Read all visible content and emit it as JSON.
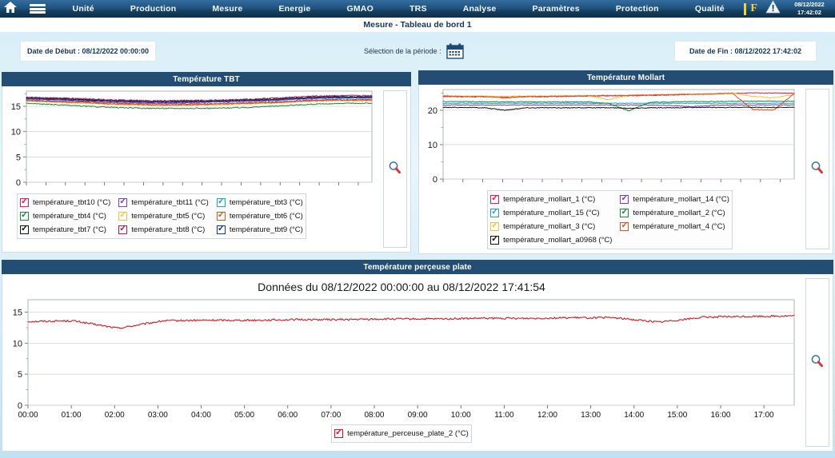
{
  "menubar": {
    "home_icon": "home-icon",
    "hamburger_icon": "hamburger-menu-icon",
    "items": [
      {
        "label": "Unité"
      },
      {
        "label": "Production"
      },
      {
        "label": "Mesure"
      },
      {
        "label": "Energie"
      },
      {
        "label": "GMAO"
      },
      {
        "label": "TRS"
      },
      {
        "label": "Analyse"
      },
      {
        "label": "Paramètres"
      },
      {
        "label": "Protection"
      },
      {
        "label": "Qualité"
      }
    ],
    "indicator_separator": "|",
    "indicator_letter": "F",
    "warning_icon": "warning-triangle-icon",
    "clock_date": "08/12/2022",
    "clock_time": "17:42:02",
    "accent_yellow": "#f4d23c",
    "bar_color": "#20527e"
  },
  "page": {
    "title": "Mesure - Tableau de bord 1"
  },
  "filters": {
    "date_debut": "Date de Début : 08/12/2022 00:00:00",
    "periode_label": "Sélection de la période :",
    "calendar_icon": "calendar-icon",
    "date_fin": "Date de Fin : 08/12/2022 17:42:02"
  },
  "panels": {
    "tbt": {
      "title": "Température TBT",
      "zoom_icon": "magnifier-icon"
    },
    "mollart": {
      "title": "Température Mollart",
      "zoom_icon": "magnifier-icon"
    },
    "perceuse": {
      "title": "Température perçeuse plate",
      "subtitle": "Données du 08/12/2022 00:00:00 au 08/12/2022 17:41:54",
      "zoom_icon": "magnifier-icon"
    }
  },
  "chart_data": [
    {
      "id": "tbt",
      "type": "line",
      "title": "Température TBT",
      "xlabel": "",
      "ylabel": "",
      "ylim": [
        0,
        18
      ],
      "yticks": [
        0,
        5,
        10,
        15
      ],
      "xlim": [
        0,
        17.7
      ],
      "grid": true,
      "legend_position": "bottom",
      "x_unit": "hours",
      "series": [
        {
          "name": "température_tbt10 (°C)",
          "color": "#e8194b",
          "checked": true,
          "values": [
            16.2,
            16.1,
            16.0,
            15.9,
            15.7,
            15.6,
            15.5,
            15.5,
            15.5,
            15.5,
            15.6,
            15.7,
            15.8,
            16.0,
            16.2,
            16.3,
            16.3,
            16.3
          ]
        },
        {
          "name": "température_tbt11 (°C)",
          "color": "#7a3fb5",
          "checked": true,
          "values": [
            16.6,
            16.5,
            16.4,
            16.3,
            16.1,
            16.0,
            15.9,
            15.9,
            15.9,
            16.0,
            16.1,
            16.2,
            16.3,
            16.5,
            16.7,
            16.8,
            16.8,
            16.8
          ]
        },
        {
          "name": "température_tbt3 (°C)",
          "color": "#1f9fe0",
          "checked": true,
          "values": [
            16.4,
            16.3,
            16.2,
            16.0,
            15.9,
            15.8,
            15.7,
            15.7,
            15.7,
            15.8,
            15.9,
            16.0,
            16.1,
            16.3,
            16.5,
            16.6,
            16.6,
            16.6
          ]
        },
        {
          "name": "température_tbt4 (°C)",
          "color": "#1b8a3a",
          "checked": true,
          "values": [
            15.6,
            15.4,
            15.2,
            15.0,
            14.8,
            14.7,
            14.6,
            14.6,
            14.6,
            14.6,
            14.7,
            14.8,
            15.0,
            15.2,
            15.4,
            15.5,
            15.6,
            15.6
          ]
        },
        {
          "name": "température_tbt5 (°C)",
          "color": "#f2c43d",
          "checked": true,
          "values": [
            16.0,
            15.9,
            15.7,
            15.6,
            15.4,
            15.3,
            15.2,
            15.2,
            15.2,
            15.3,
            15.4,
            15.5,
            15.6,
            15.8,
            16.0,
            16.1,
            16.1,
            16.1
          ]
        },
        {
          "name": "température_tbt6 (°C)",
          "color": "#e0521a",
          "checked": true,
          "values": [
            16.1,
            16.0,
            15.8,
            15.7,
            15.5,
            15.4,
            15.3,
            15.3,
            15.3,
            15.4,
            15.5,
            15.6,
            15.7,
            15.9,
            16.1,
            16.2,
            16.2,
            16.2
          ]
        },
        {
          "name": "température_tbt7 (°C)",
          "color": "#111111",
          "checked": true,
          "values": [
            16.7,
            16.6,
            16.5,
            16.3,
            16.2,
            16.1,
            16.0,
            16.0,
            16.0,
            16.1,
            16.2,
            16.3,
            16.4,
            16.6,
            16.8,
            16.9,
            16.9,
            16.9
          ]
        },
        {
          "name": "température_tbt8 (°C)",
          "color": "#b5185b",
          "checked": true,
          "values": [
            16.8,
            16.7,
            16.6,
            16.5,
            16.3,
            16.2,
            16.1,
            16.1,
            16.2,
            16.2,
            16.3,
            16.4,
            16.6,
            16.8,
            17.0,
            17.1,
            17.1,
            17.1
          ]
        },
        {
          "name": "température_tbt9 (°C)",
          "color": "#1a2f9e",
          "checked": true,
          "values": [
            16.5,
            16.4,
            16.3,
            16.1,
            16.0,
            15.9,
            15.8,
            15.8,
            15.8,
            15.9,
            16.0,
            16.1,
            16.2,
            16.4,
            16.6,
            16.7,
            16.7,
            16.7
          ]
        }
      ]
    },
    {
      "id": "mollart",
      "type": "line",
      "title": "Température Mollart",
      "xlabel": "",
      "ylabel": "",
      "ylim": [
        0,
        26
      ],
      "yticks": [
        0,
        10,
        20
      ],
      "xlim": [
        0,
        17.7
      ],
      "grid": true,
      "legend_position": "bottom",
      "x_unit": "hours",
      "series": [
        {
          "name": "température_mollart_1 (°C)",
          "color": "#e8194b",
          "checked": true,
          "values": [
            24.0,
            23.9,
            23.9,
            23.8,
            23.9,
            23.9,
            24.0,
            24.1,
            24.2,
            24.2,
            24.3,
            24.4,
            24.6,
            24.7,
            24.9,
            25.0,
            25.0,
            24.9
          ]
        },
        {
          "name": "température_mollart_14 (°C)",
          "color": "#7a3fb5",
          "checked": true,
          "values": [
            21.5,
            21.5,
            21.5,
            21.5,
            21.5,
            21.5,
            21.5,
            21.5,
            21.5,
            21.5,
            21.5,
            21.4,
            21.0,
            21.4,
            21.5,
            21.5,
            21.5,
            21.5
          ]
        },
        {
          "name": "température_mollart_15 (°C)",
          "color": "#1f9fe0",
          "checked": true,
          "values": [
            22.0,
            22.0,
            22.0,
            22.0,
            22.0,
            22.0,
            22.0,
            22.0,
            22.0,
            22.0,
            22.0,
            22.0,
            22.0,
            22.0,
            22.0,
            22.0,
            22.0,
            22.0
          ]
        },
        {
          "name": "température_mollart_2 (°C)",
          "color": "#1b8a3a",
          "checked": true,
          "values": [
            22.5,
            22.5,
            22.4,
            22.4,
            22.4,
            22.4,
            22.4,
            22.4,
            22.0,
            19.8,
            22.3,
            22.4,
            22.5,
            22.5,
            22.6,
            22.6,
            22.6,
            22.6
          ]
        },
        {
          "name": "température_mollart_3 (°C)",
          "color": "#f2c43d",
          "checked": true,
          "values": [
            24.2,
            24.1,
            24.1,
            24.0,
            24.1,
            24.1,
            24.2,
            24.3,
            23.0,
            24.4,
            24.5,
            24.6,
            24.7,
            24.8,
            25.0,
            24.0,
            23.6,
            24.6
          ]
        },
        {
          "name": "température_mollart_4 (°C)",
          "color": "#e0521a",
          "checked": true,
          "values": [
            24.1,
            24.0,
            24.0,
            23.5,
            24.0,
            24.0,
            24.1,
            24.2,
            24.3,
            24.3,
            24.4,
            24.5,
            24.6,
            24.7,
            24.9,
            20.2,
            20.0,
            24.8
          ]
        },
        {
          "name": "température_mollart_a0968 (°C)",
          "color": "#111111",
          "checked": true,
          "values": [
            20.8,
            20.8,
            20.7,
            20.0,
            20.7,
            20.7,
            20.7,
            20.7,
            20.7,
            20.6,
            20.7,
            20.7,
            20.8,
            20.8,
            20.8,
            20.8,
            20.8,
            20.8
          ]
        }
      ]
    },
    {
      "id": "perceuse",
      "type": "line",
      "title": "Température perçeuse plate",
      "subtitle": "Données du 08/12/2022 00:00:00 au 08/12/2022 17:41:54",
      "xlabel": "",
      "ylabel": "",
      "ylim": [
        0,
        17
      ],
      "yticks": [
        0,
        5,
        10,
        15
      ],
      "xlim": [
        0,
        17.7
      ],
      "grid": true,
      "legend_position": "bottom",
      "x_unit": "hours",
      "xticks": [
        "00:00",
        "01:00",
        "02:00",
        "03:00",
        "04:00",
        "05:00",
        "06:00",
        "07:00",
        "08:00",
        "09:00",
        "10:00",
        "11:00",
        "12:00",
        "13:00",
        "14:00",
        "15:00",
        "16:00",
        "17:00"
      ],
      "series": [
        {
          "name": "température_perceuse_plate_2 (°C)",
          "color": "#d81621",
          "checked": true,
          "values": [
            13.5,
            13.6,
            12.4,
            13.6,
            13.7,
            13.7,
            13.8,
            13.8,
            13.9,
            13.9,
            14.0,
            14.0,
            14.1,
            14.1,
            13.4,
            14.2,
            14.3,
            14.4
          ]
        }
      ]
    }
  ]
}
